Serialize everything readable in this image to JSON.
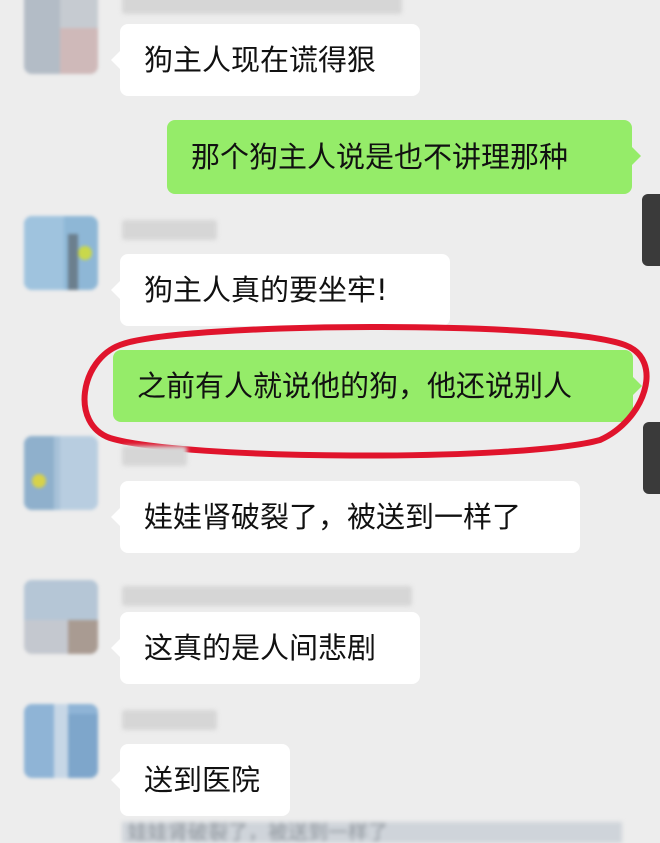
{
  "chat": {
    "messages": [
      {
        "side": "recv",
        "text": "狗主人现在谎得狠"
      },
      {
        "side": "sent",
        "text": "那个狗主人说是也不讲理那种"
      },
      {
        "side": "recv",
        "text": "狗主人真的要坐牢!"
      },
      {
        "side": "sent",
        "text": "之前有人就说他的狗，他还说别人",
        "highlighted": true
      },
      {
        "side": "recv",
        "text": "娃娃肾破裂了，被送到一样了"
      },
      {
        "side": "recv",
        "text": "这真的是人间悲剧"
      },
      {
        "side": "recv",
        "text": "送到医院"
      }
    ],
    "obscured_preview": "娃娃肾破裂了，被送到一样了",
    "highlight_color": "#e0142c",
    "sent_bubble_color": "#95ec69",
    "recv_bubble_color": "#ffffff",
    "background_color": "#ededed"
  }
}
